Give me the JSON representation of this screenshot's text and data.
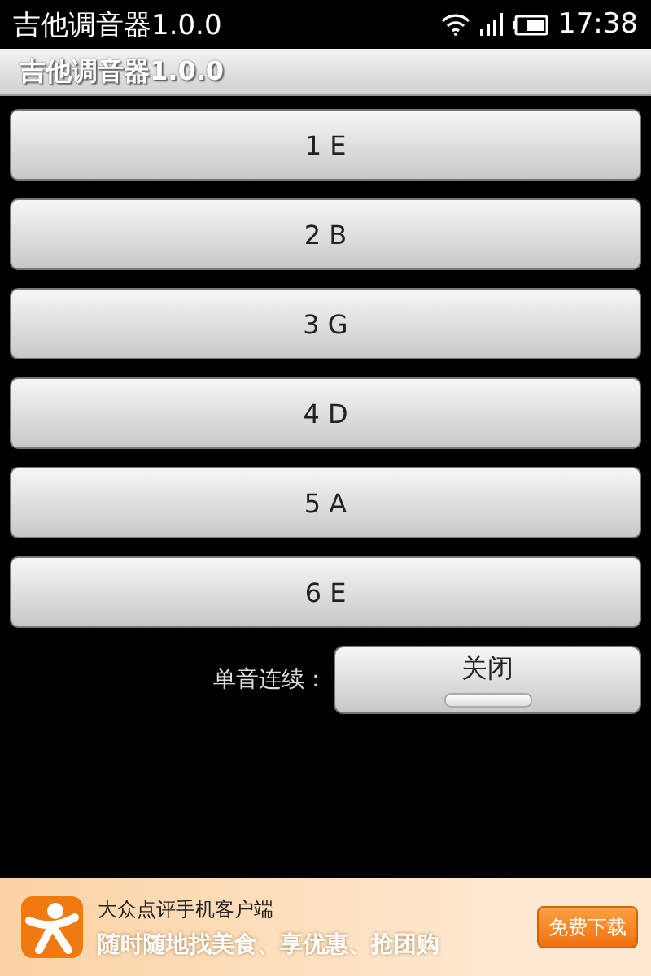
{
  "status_bar": {
    "app_name": "吉他调音器1.0.0",
    "time": "17:38"
  },
  "title_bar": {
    "title": "吉他调音器1.0.0"
  },
  "strings": [
    {
      "label": "1 E"
    },
    {
      "label": "2 B"
    },
    {
      "label": "3 G"
    },
    {
      "label": "4 D"
    },
    {
      "label": "5 A"
    },
    {
      "label": "6 E"
    }
  ],
  "continuous": {
    "label": "单音连续：",
    "toggle_text": "关闭",
    "on": false
  },
  "ad_banner": {
    "title": "大众点评手机客户端",
    "slogan": "随时随地找美食、享优惠、抢团购",
    "button": "免费下载"
  }
}
